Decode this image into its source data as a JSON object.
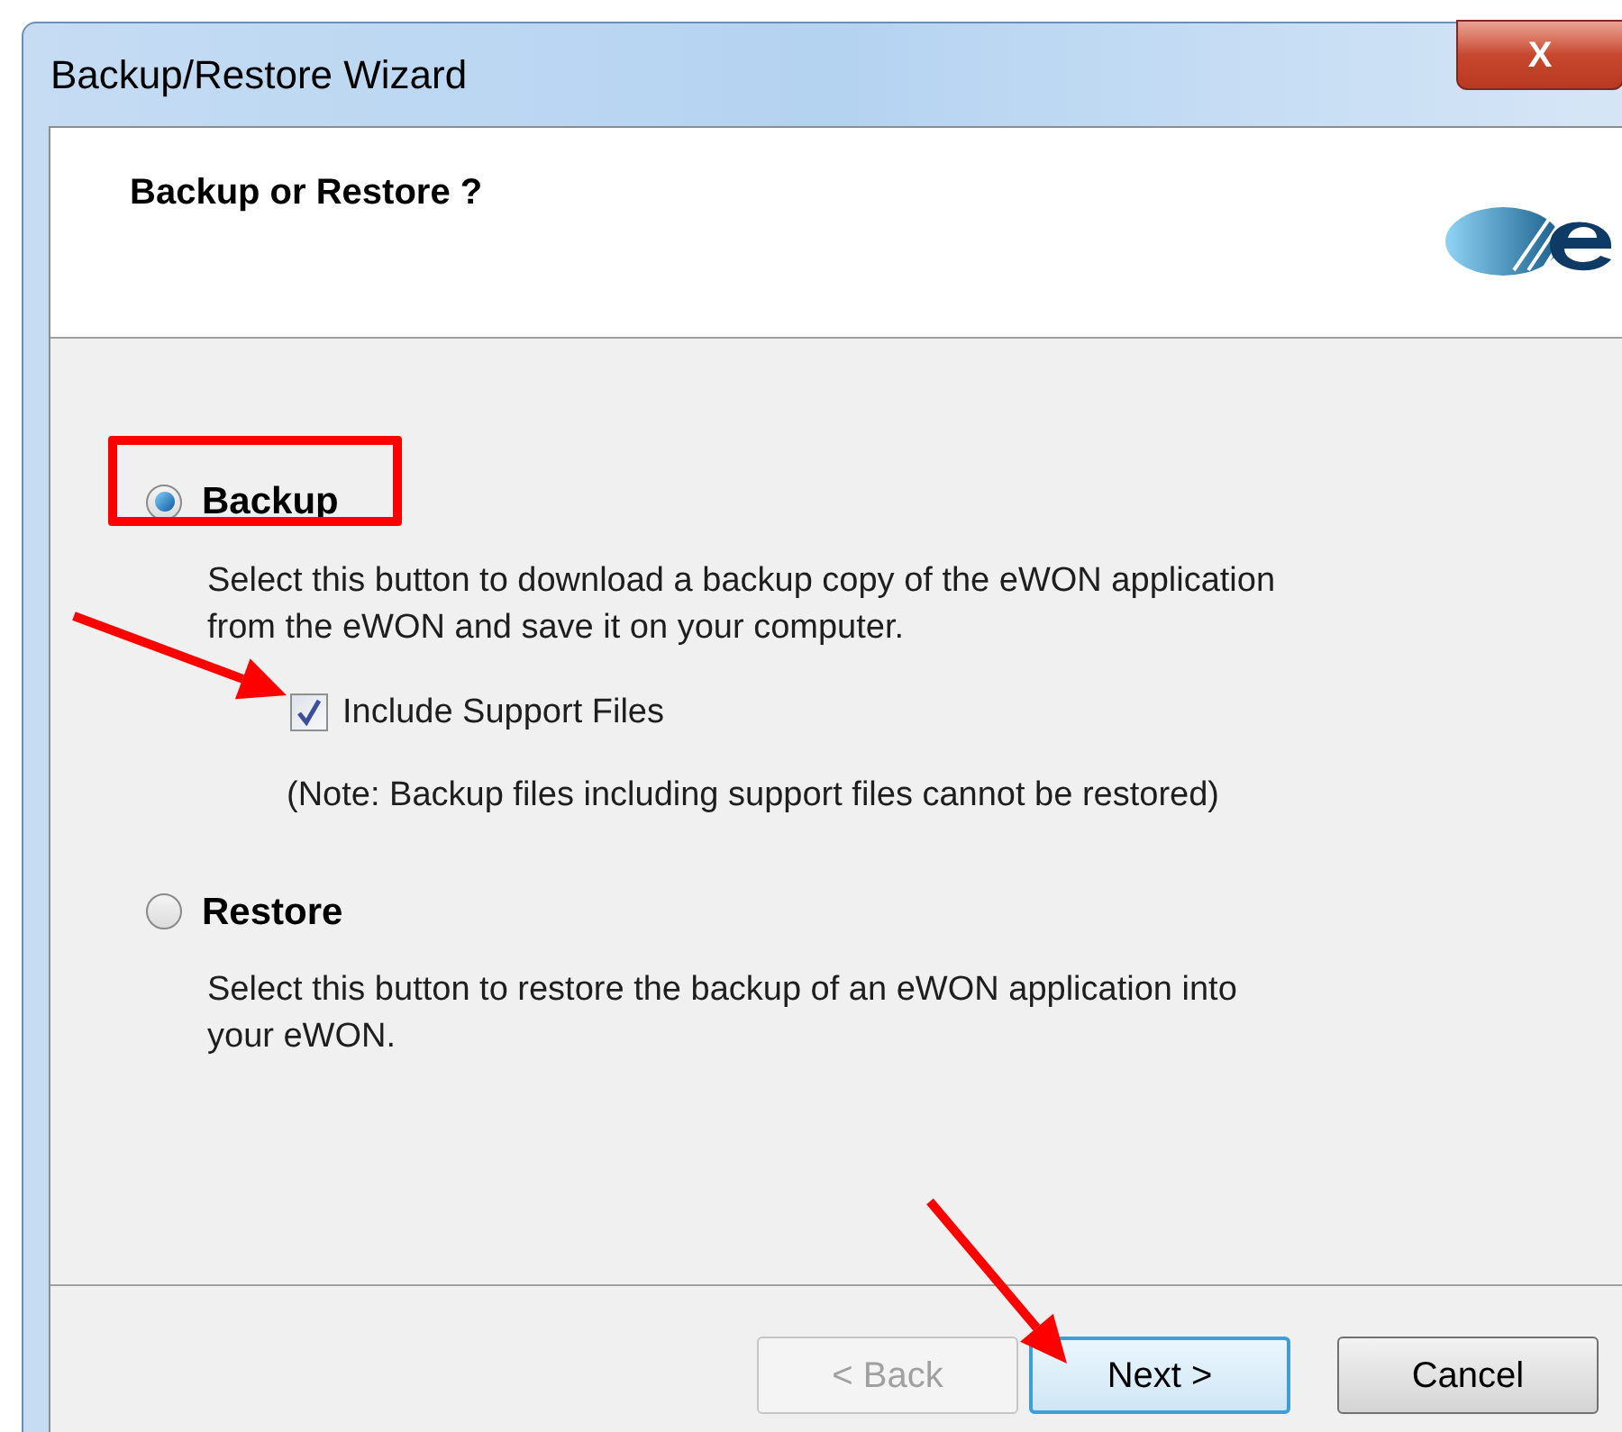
{
  "window": {
    "title": "Backup/Restore Wizard",
    "close_label": "X"
  },
  "header": {
    "title": "Backup or Restore ?"
  },
  "options": [
    {
      "label": "Backup",
      "selected": true,
      "highlighted": true,
      "description": "Select this button to download a backup copy of the eWON application from the eWON and save it on your computer.",
      "checkbox": {
        "label": "Include Support Files",
        "checked": true,
        "pointed_at": true
      },
      "note": "(Note: Backup files including support files cannot be restored)"
    },
    {
      "label": "Restore",
      "selected": false,
      "highlighted": false,
      "description": "Select this button to restore the backup of an eWON application into your eWON."
    }
  ],
  "buttons": [
    {
      "label": "< Back",
      "disabled": true,
      "focused": false,
      "pointed_at": false
    },
    {
      "label": "Next >",
      "disabled": false,
      "focused": true,
      "pointed_at": true
    },
    {
      "label": "Cancel",
      "disabled": false,
      "focused": false,
      "pointed_at": false
    }
  ]
}
